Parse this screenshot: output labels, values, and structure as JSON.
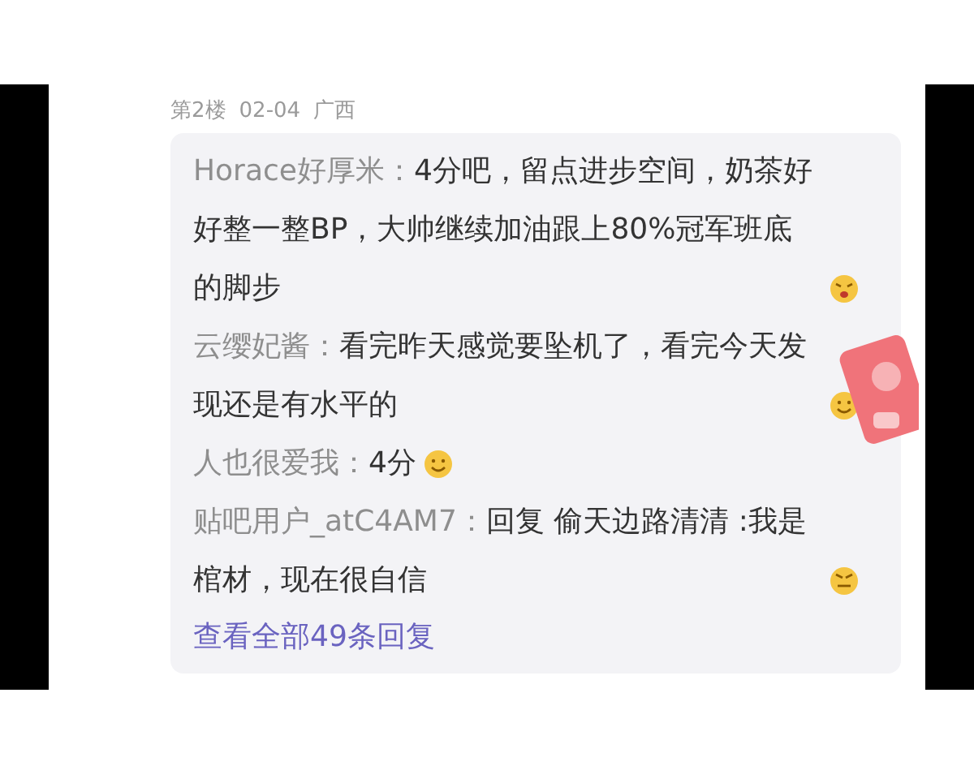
{
  "post_meta": {
    "floor": "第2楼",
    "date": "02-04",
    "location": "广西"
  },
  "replies": [
    {
      "author": "Horace好厚米：",
      "text": "4分吧，留点进步空间，奶茶好好整一整BP，大帅继续加油跟上80%冠军班底的脚步",
      "kind": "shocked"
    },
    {
      "author": "云缨妃酱：",
      "text": "看完昨天感觉要坠机了，看完今天发现还是有水平的",
      "kind": "smile"
    },
    {
      "author": "人也很爱我：",
      "text": "4分",
      "kind": "smile"
    },
    {
      "author": "贴吧用户_atC4AM7：",
      "text": "回复 偷天边路清清 :我是棺材，现在很自信",
      "kind": "proud"
    }
  ],
  "view_all_link": "查看全部49条回复"
}
